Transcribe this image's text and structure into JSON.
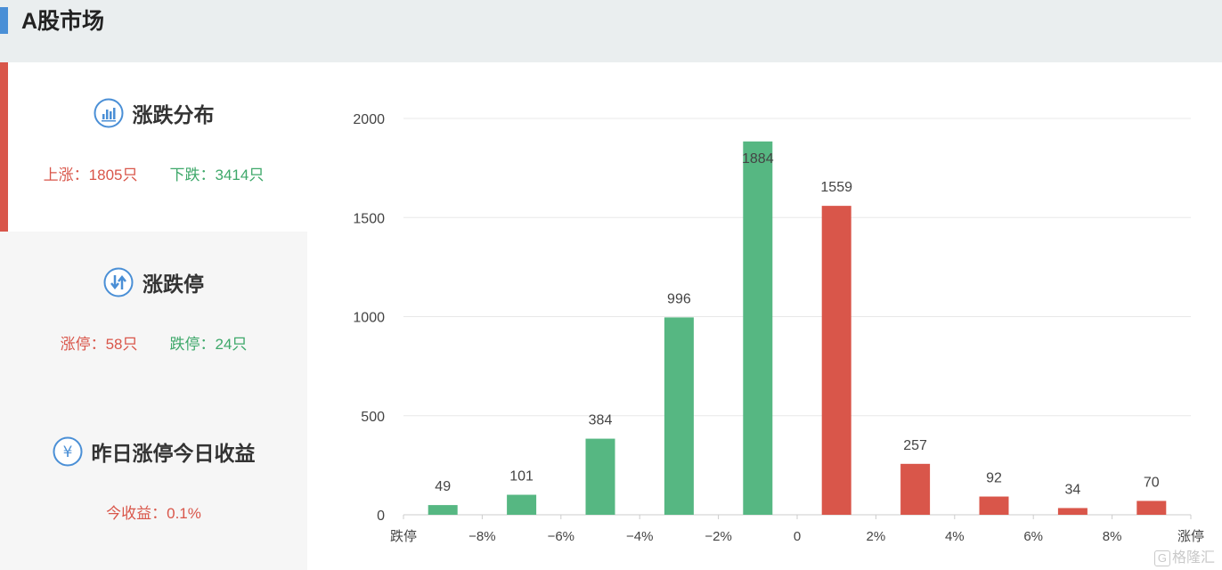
{
  "header": {
    "title": "A股市场"
  },
  "panels": [
    {
      "title": "涨跌分布",
      "icon": "bar-chart-icon",
      "stats": [
        {
          "text": "上涨：1805只",
          "tone": "up"
        },
        {
          "text": "下跌：3414只",
          "tone": "down"
        }
      ]
    },
    {
      "title": "涨跌停",
      "icon": "up-down-arrows-icon",
      "stats": [
        {
          "text": "涨停：58只",
          "tone": "up"
        },
        {
          "text": "跌停：24只",
          "tone": "down"
        }
      ]
    },
    {
      "title": "昨日涨停今日收益",
      "icon": "yen-icon",
      "stats": [
        {
          "text": "今收益：0.1%",
          "tone": "up"
        }
      ]
    }
  ],
  "colors": {
    "up": "#d9564a",
    "down": "#56b782",
    "accent": "#4a8fd6"
  },
  "chart_data": {
    "type": "bar",
    "categories": [
      "跌停",
      "-8%~-10%",
      "-6%~-8%",
      "-4%~-6%",
      "-2%~-4%",
      "0~-2%",
      "0~2%",
      "2%~4%",
      "4%~6%",
      "6%~8%",
      "涨停"
    ],
    "values": [
      49,
      101,
      384,
      996,
      1884,
      1559,
      257,
      92,
      34,
      70
    ],
    "bar_groups": [
      {
        "value": 49,
        "slot": 0,
        "color": "down"
      },
      {
        "value": 101,
        "slot": 1,
        "color": "down"
      },
      {
        "value": 384,
        "slot": 2,
        "color": "down"
      },
      {
        "value": 996,
        "slot": 3,
        "color": "down"
      },
      {
        "value": 1884,
        "slot": 4,
        "color": "down"
      },
      {
        "value": 1559,
        "slot": 5,
        "color": "up"
      },
      {
        "value": 257,
        "slot": 6,
        "color": "up"
      },
      {
        "value": 92,
        "slot": 7,
        "color": "up"
      },
      {
        "value": 34,
        "slot": 8,
        "color": "up"
      },
      {
        "value": 70,
        "slot": 9,
        "color": "up"
      }
    ],
    "xticks": [
      "跌停",
      "−8%",
      "−6%",
      "−4%",
      "−2%",
      "0",
      "2%",
      "4%",
      "6%",
      "8%",
      "涨停"
    ],
    "yticks": [
      0,
      500,
      1000,
      1500,
      2000
    ],
    "ylim": [
      0,
      2000
    ],
    "grid": true
  },
  "watermark": {
    "text": "格隆汇"
  }
}
